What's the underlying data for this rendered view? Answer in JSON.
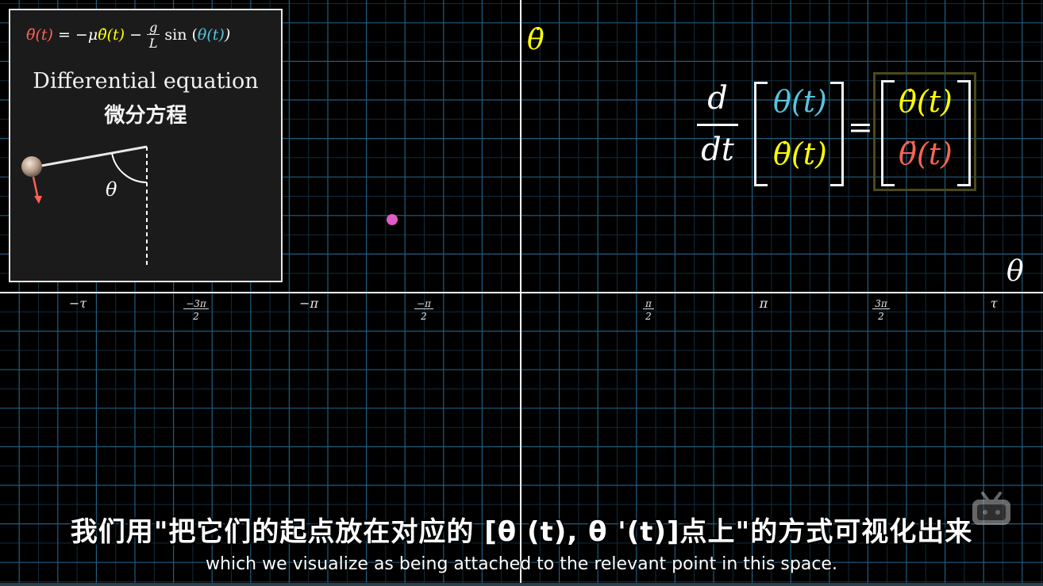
{
  "plot": {
    "y_axis_label": "θ̇",
    "x_axis_label": "θ",
    "x_ticks": [
      {
        "num": "−τ",
        "den": ""
      },
      {
        "num": "−3π",
        "den": "2"
      },
      {
        "num": "−π",
        "den": ""
      },
      {
        "num": "−π",
        "den": "2"
      },
      {
        "num": "π",
        "den": "2"
      },
      {
        "num": "π",
        "den": ""
      },
      {
        "num": "3π",
        "den": "2"
      },
      {
        "num": "τ",
        "den": ""
      }
    ],
    "point": {
      "theta": -1.5708,
      "theta_dot": 1.0
    },
    "colors": {
      "grid": "#1f5e80",
      "grid_minor": "#122c3c",
      "axis": "#ffffff",
      "point": "#e05bc4"
    }
  },
  "inset": {
    "equation": {
      "lhs": "θ̈(t)",
      "eq": " = −μ",
      "term1": "θ̇(t)",
      "minus": " − ",
      "g": "g",
      "L": "L",
      "sin": " sin (",
      "term2": "θ(t)",
      "close": ")"
    },
    "title": "Differential equation",
    "title_zh": "微分方程",
    "angle_label": "θ",
    "colors": {
      "theta": "#58c4dd",
      "theta_dot": "#ffff00",
      "theta_ddot": "#fc6255",
      "arrow": "#fc6255"
    }
  },
  "main_equation": {
    "d": "d",
    "dt": "dt",
    "left_top": "θ(t)",
    "left_bottom": "θ̇(t)",
    "equals": "=",
    "right_top": "θ̇(t)",
    "right_bottom": "θ̈(t)"
  },
  "subtitles": {
    "zh": "我们用\"把它们的起点放在对应的 [θ (t), θ '(t)]点上\"的方式可视化出来",
    "en": "which we visualize as being attached to the relevant point in this space."
  },
  "watermark": {
    "icon": "bilibili-tv-icon"
  }
}
